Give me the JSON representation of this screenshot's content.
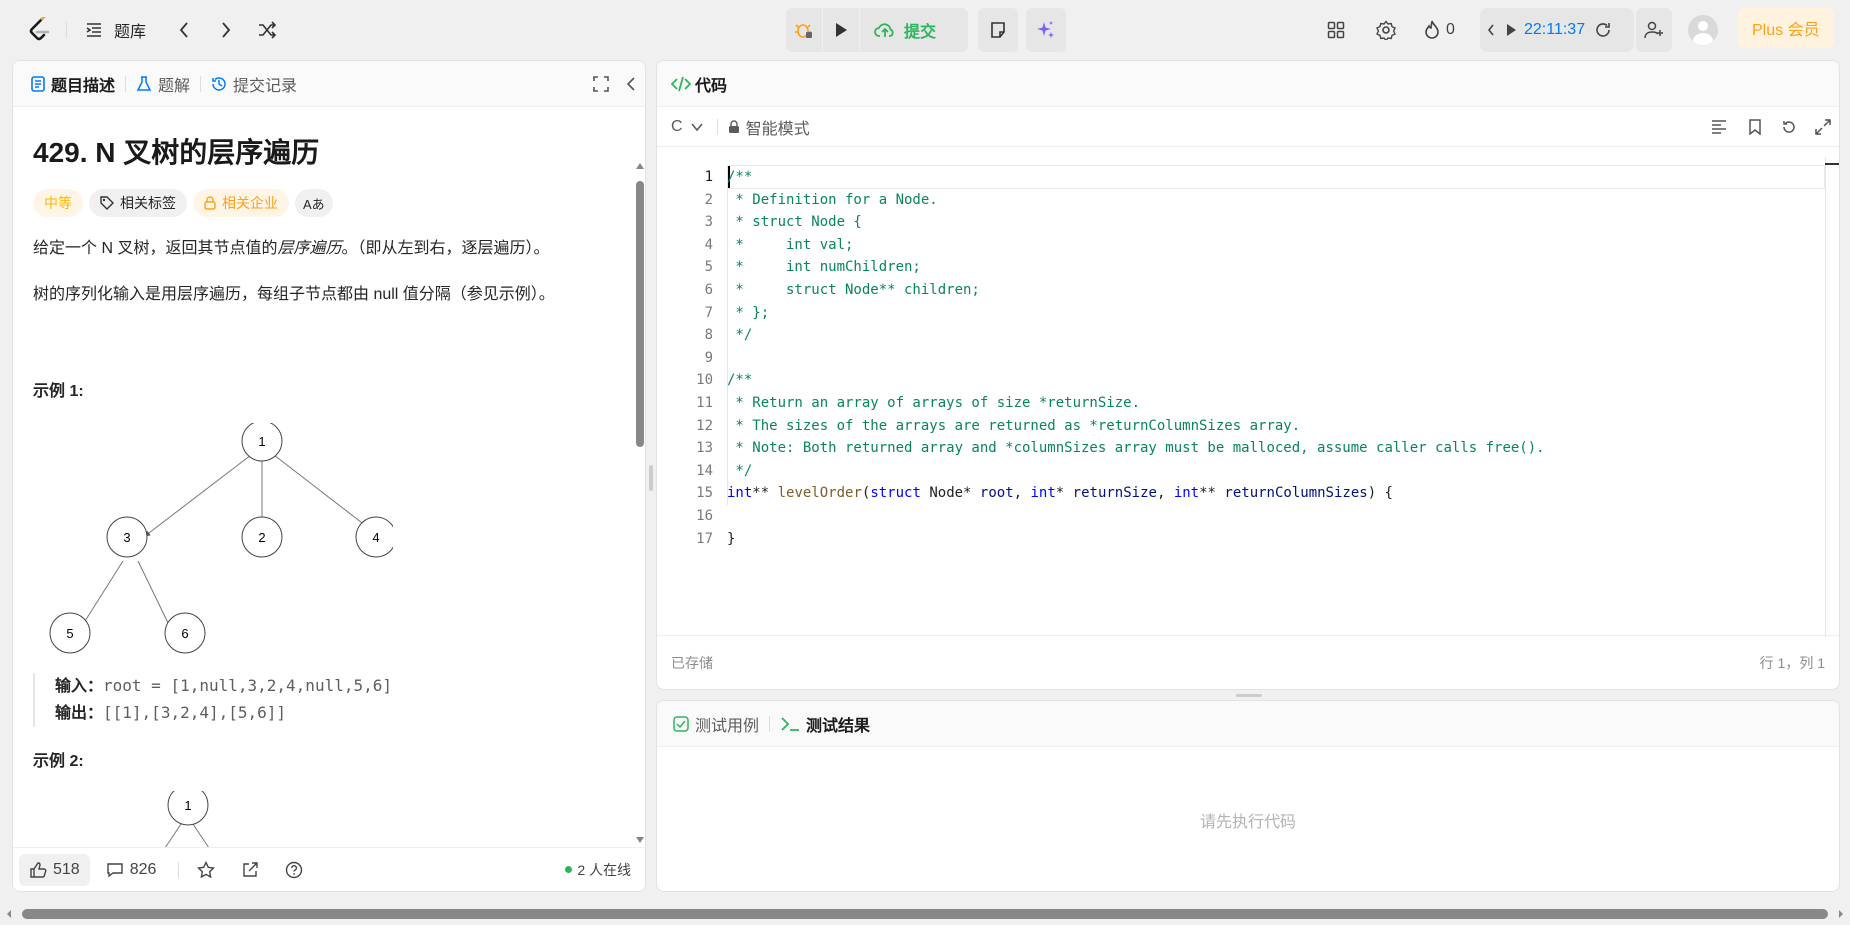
{
  "topbar": {
    "problem_list": "题库",
    "submit": "提交",
    "streak": "0",
    "timer": "22:11:37",
    "plus": "Plus 会员"
  },
  "left_panel": {
    "tabs": [
      {
        "label": "题目描述"
      },
      {
        "label": "题解"
      },
      {
        "label": "提交记录"
      }
    ],
    "title": "429. N 叉树的层序遍历",
    "tags": {
      "difficulty": "中等",
      "related_tags": "相关标签",
      "companies": "相关企业",
      "translate": "Aあ"
    },
    "description": {
      "p1_before": "给定一个 N 叉树，返回其节点值的",
      "p1_em": "层序遍历",
      "p1_after": "。（即从左到右，逐层遍历）。",
      "p2": "树的序列化输入是用层序遍历，每组子节点都由 null 值分隔（参见示例）。"
    },
    "example1": {
      "title": "示例 1:",
      "input_label": "输入：",
      "input_value": "root = [1,null,3,2,4,null,5,6]",
      "output_label": "输出：",
      "output_value": "[[1],[3,2,4],[5,6]]"
    },
    "tree1": {
      "n1": "1",
      "n3": "3",
      "n2": "2",
      "n4": "4",
      "n5": "5",
      "n6": "6"
    },
    "example2": {
      "title": "示例 2:",
      "root": "1"
    },
    "footer": {
      "likes": "518",
      "comments": "826",
      "online": "2 人在线"
    }
  },
  "code_panel": {
    "title": "代码",
    "language": "C",
    "mode": "智能模式",
    "saved": "已存储",
    "cursor": "行 1，列 1",
    "lines": {
      "l1": "/**",
      "l2": " * Definition for a Node.",
      "l3": " * struct Node {",
      "l4": " *     int val;",
      "l5": " *     int numChildren;",
      "l6": " *     struct Node** children;",
      "l7": " * };",
      "l8": " */",
      "l9": "",
      "l10": "/**",
      "l11": " * Return an array of arrays of size *returnSize.",
      "l12": " * The sizes of the arrays are returned as *returnColumnSizes array.",
      "l13": " * Note: Both returned array and *columnSizes array must be malloced, assume caller calls free().",
      "l14": " */",
      "l16": "",
      "l17": "}"
    },
    "l15": {
      "t1": "int",
      "t2": "** ",
      "t3": "levelOrder",
      "t4": "(",
      "t5": "struct",
      "t6": " Node* ",
      "t7": "root",
      "t8": ", ",
      "t9": "int",
      "t10": "* ",
      "t11": "returnSize",
      "t12": ", ",
      "t13": "int",
      "t14": "** ",
      "t15": "returnColumnSizes",
      "t16": ") {"
    },
    "line_numbers": [
      "1",
      "2",
      "3",
      "4",
      "5",
      "6",
      "7",
      "8",
      "9",
      "10",
      "11",
      "12",
      "13",
      "14",
      "15",
      "16",
      "17"
    ]
  },
  "result_panel": {
    "tabs": [
      {
        "label": "测试用例"
      },
      {
        "label": "测试结果"
      }
    ],
    "placeholder": "请先执行代码"
  },
  "colors": {
    "accent_green": "#2db55d",
    "accent_orange": "#ffa116",
    "brand_blue": "#007aff",
    "plus_bg": "#fff3e0"
  }
}
